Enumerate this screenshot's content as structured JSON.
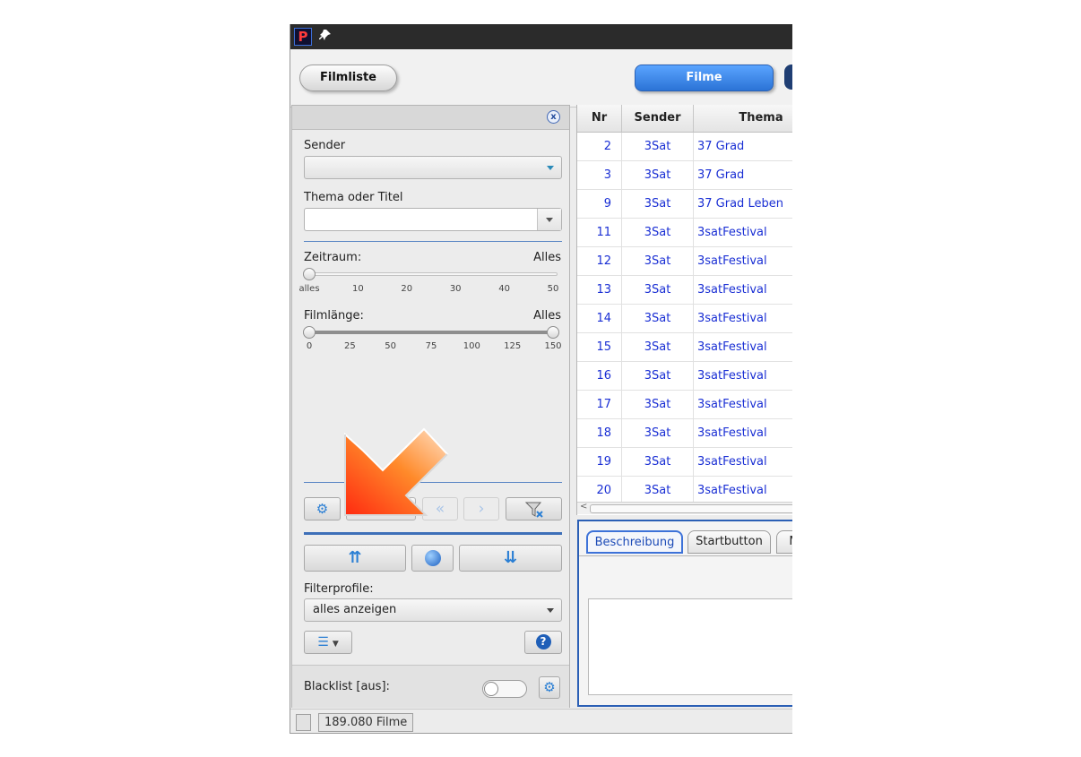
{
  "window": {
    "logo_letter": "P",
    "pin_glyph": "★"
  },
  "toolbar": {
    "filmliste_label": "Filmliste",
    "filme_label": "Filme"
  },
  "filter": {
    "close_glyph": "x",
    "sender_label": "Sender",
    "sender_value": "",
    "thema_label": "Thema oder Titel",
    "thema_value": "",
    "zeitraum_label": "Zeitraum:",
    "zeitraum_value": "Alles",
    "zeitraum_ticks": [
      "alles",
      "10",
      "20",
      "30",
      "40",
      "50"
    ],
    "zeitraum_level": 0,
    "filmlaenge_label": "Filmlänge:",
    "filmlaenge_value": "Alles",
    "filmlaenge_ticks": [
      "0",
      "25",
      "50",
      "75",
      "100",
      "125",
      "150"
    ],
    "filmlaenge_min": 0,
    "filmlaenge_max": 150,
    "profile_label": "Filterprofile:",
    "profile_value": "alles anzeigen",
    "blacklist_label": "Blacklist [aus]:"
  },
  "table": {
    "columns": [
      "Nr",
      "Sender",
      "Thema"
    ],
    "rows": [
      [
        "2",
        "3Sat",
        "37 Grad"
      ],
      [
        "3",
        "3Sat",
        "37 Grad"
      ],
      [
        "9",
        "3Sat",
        "37 Grad Leben"
      ],
      [
        "11",
        "3Sat",
        "3satFestival"
      ],
      [
        "12",
        "3Sat",
        "3satFestival"
      ],
      [
        "13",
        "3Sat",
        "3satFestival"
      ],
      [
        "14",
        "3Sat",
        "3satFestival"
      ],
      [
        "15",
        "3Sat",
        "3satFestival"
      ],
      [
        "16",
        "3Sat",
        "3satFestival"
      ],
      [
        "17",
        "3Sat",
        "3satFestival"
      ],
      [
        "18",
        "3Sat",
        "3satFestival"
      ],
      [
        "19",
        "3Sat",
        "3satFestival"
      ],
      [
        "20",
        "3Sat",
        "3satFestival"
      ]
    ]
  },
  "tabs": [
    "Beschreibung",
    "Startbutton",
    "M"
  ],
  "status": {
    "count": "189.080 Filme"
  },
  "colors": {
    "accent": "#2b73d6",
    "link_text": "#1a2fd4",
    "arrow": "#ff6a1a"
  }
}
